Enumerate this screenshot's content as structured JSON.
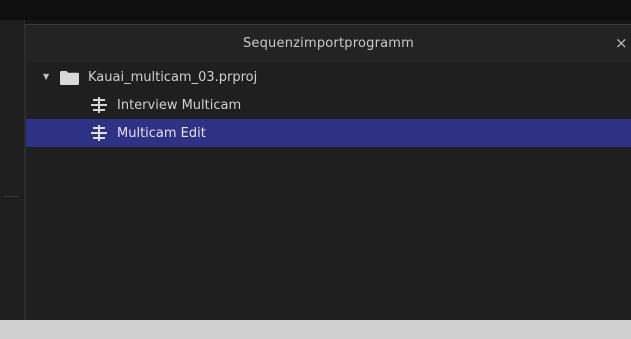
{
  "dialog": {
    "title": "Sequenzimportprogramm",
    "close_label": "×"
  },
  "tree": {
    "project": {
      "expand_glyph": "▼",
      "icon": "folder-icon",
      "label": "Kauai_multicam_03.prproj"
    },
    "items": [
      {
        "icon": "sequence-icon",
        "label": "Interview Multicam",
        "selected": false
      },
      {
        "icon": "sequence-icon",
        "label": "Multicam Edit",
        "selected": true
      }
    ]
  },
  "colors": {
    "dialog_bg": "#1f1f1f",
    "titlebar_bg": "#232323",
    "selection": "#2f3185",
    "text": "#cfcfcf"
  }
}
